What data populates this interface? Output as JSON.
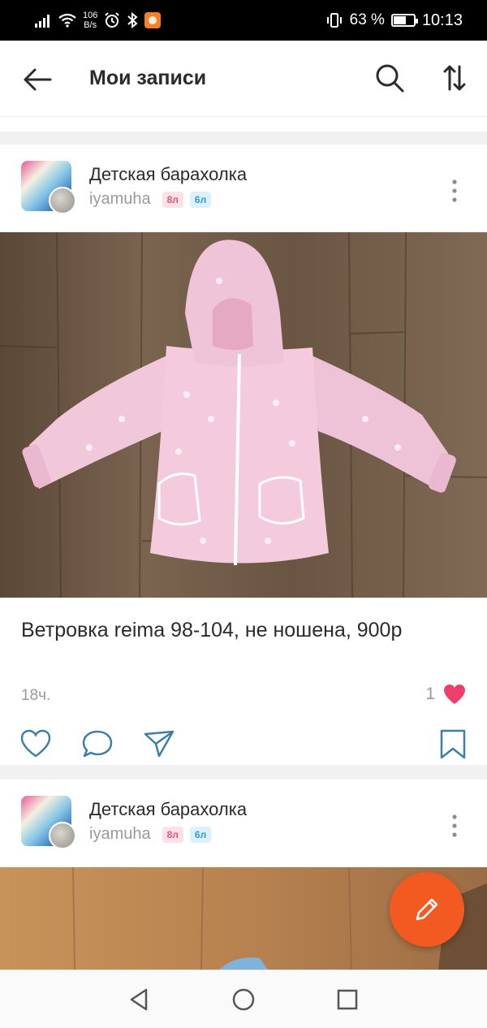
{
  "status_bar": {
    "net_speed_value": "106",
    "net_speed_unit": "B/s",
    "battery_percent": "63 %",
    "battery_level": 0.63,
    "time": "10:13",
    "icons": [
      "signal-icon",
      "wifi-icon",
      "alarm-icon",
      "bluetooth-icon",
      "app-notification-icon",
      "vibrate-icon",
      "battery-icon"
    ]
  },
  "header": {
    "title": "Мои записи",
    "icons": [
      "back-arrow-icon",
      "search-icon",
      "sort-icon"
    ]
  },
  "posts": [
    {
      "group": "Детская барахолка",
      "author": "iyamuha",
      "badges": [
        "8л",
        "6л"
      ],
      "caption": "Ветровка reima 98-104, не ношена, 900р",
      "time": "18ч.",
      "likes": "1"
    },
    {
      "group": "Детская барахолка",
      "author": "iyamuha",
      "badges": [
        "8л",
        "6л"
      ]
    }
  ],
  "colors": {
    "accent": "#f25a22",
    "like_heart": "#ec3f6c",
    "badge_pink": "#e0567d",
    "badge_blue": "#2d9cd6",
    "wood_floor": "#6f5a44",
    "jacket_pink": "#f1c7da"
  },
  "fab": {
    "icon": "pencil-icon"
  },
  "nav_bar": {
    "icons": [
      "back-triangle-icon",
      "home-circle-icon",
      "recents-square-icon"
    ]
  }
}
